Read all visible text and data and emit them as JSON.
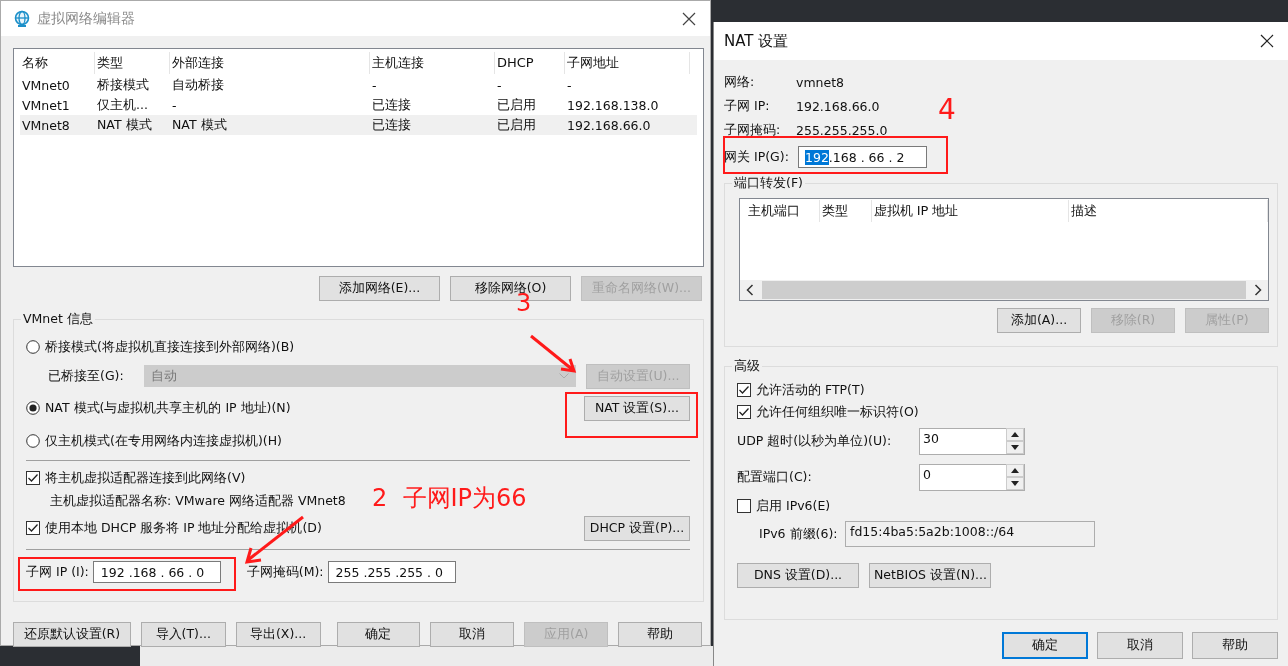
{
  "editor_window": {
    "title": "虚拟网络编辑器",
    "network_table": {
      "columns": [
        "名称",
        "类型",
        "外部连接",
        "主机连接",
        "DHCP",
        "子网地址"
      ],
      "rows": [
        {
          "cells": [
            "VMnet0",
            "桥接模式",
            "自动桥接",
            "-",
            "-",
            "-"
          ],
          "selected": false
        },
        {
          "cells": [
            "VMnet1",
            "仅主机...",
            "-",
            "已连接",
            "已启用",
            "192.168.138.0"
          ],
          "selected": false
        },
        {
          "cells": [
            "VMnet8",
            "NAT 模式",
            "NAT 模式",
            "已连接",
            "已启用",
            "192.168.66.0"
          ],
          "selected": true
        }
      ]
    },
    "table_buttons": [
      {
        "label": "添加网络(E)...",
        "disabled": false
      },
      {
        "label": "移除网络(O)",
        "disabled": false
      },
      {
        "label": "重命名网络(W)...",
        "disabled": true
      }
    ],
    "vmnet_info": {
      "title": "VMnet 信息",
      "modes": [
        {
          "label": "桥接模式(将虚拟机直接连接到外部网络)(B)",
          "selected": false
        },
        {
          "label": "NAT 模式(与虚拟机共享主机的 IP 地址)(N)",
          "selected": true
        },
        {
          "label": "仅主机模式(在专用网络内连接虚拟机)(H)",
          "selected": false
        }
      ],
      "bridged_to": {
        "label": "已桥接至(G):",
        "value": "自动",
        "disabled": true
      },
      "auto_settings_button": {
        "label": "自动设置(U)...",
        "disabled": true
      },
      "nat_settings_button": {
        "label": "NAT 设置(S)...",
        "disabled": false
      },
      "connect_adapter": {
        "label": "将主机虚拟适配器连接到此网络(V)",
        "checked": true
      },
      "adapter_name": "主机虚拟适配器名称: VMware 网络适配器 VMnet8",
      "use_dhcp": {
        "label": "使用本地 DHCP 服务将 IP 地址分配给虚拟机(D)",
        "checked": true
      },
      "dhcp_settings_button": {
        "label": "DHCP 设置(P)...",
        "disabled": false
      },
      "subnet_ip": {
        "label": "子网 IP (I):",
        "value": "192 .168 . 66 . 0"
      },
      "subnet_mask": {
        "label": "子网掩码(M):",
        "value": "255 .255 .255 . 0"
      }
    },
    "footer_buttons": [
      {
        "label": "还原默认设置(R)",
        "disabled": false
      },
      {
        "label": "导入(T)...",
        "disabled": false
      },
      {
        "label": "导出(X)...",
        "disabled": false
      },
      {
        "label": "确定",
        "disabled": false
      },
      {
        "label": "取消",
        "disabled": false
      },
      {
        "label": "应用(A)",
        "disabled": true
      },
      {
        "label": "帮助",
        "disabled": false
      }
    ]
  },
  "nat_window": {
    "title": "NAT 设置",
    "info": [
      {
        "label": "网络:",
        "value": "vmnet8"
      },
      {
        "label": "子网 IP:",
        "value": "192.168.66.0"
      },
      {
        "label": "子网掩码:",
        "value": "255.255.255.0"
      }
    ],
    "gateway": {
      "label": "网关 IP(G):",
      "segments": [
        {
          "text": "192",
          "selected": true
        },
        {
          "text": ".168 . 66 . 2",
          "selected": false
        }
      ]
    },
    "port_forwarding": {
      "title": "端口转发(F)",
      "columns": [
        "主机端口",
        "类型",
        "虚拟机 IP 地址",
        "描述"
      ],
      "buttons": [
        {
          "label": "添加(A)...",
          "disabled": false
        },
        {
          "label": "移除(R)",
          "disabled": true
        },
        {
          "label": "属性(P)",
          "disabled": true
        }
      ]
    },
    "advanced": {
      "title": "高级",
      "checks": [
        {
          "label": "允许活动的 FTP(T)",
          "checked": true
        },
        {
          "label": "允许任何组织唯一标识符(O)",
          "checked": true
        }
      ],
      "spinners": [
        {
          "label": "UDP 超时(以秒为单位)(U):",
          "value": "30"
        },
        {
          "label": "配置端口(C):",
          "value": "0"
        }
      ],
      "ipv6": {
        "label": "启用 IPv6(E)",
        "checked": false
      },
      "ipv6_prefix": {
        "label": "IPv6 前缀(6):",
        "value": "fd15:4ba5:5a2b:1008::/64"
      },
      "buttons": [
        {
          "label": "DNS 设置(D)...",
          "disabled": false
        },
        {
          "label": "NetBIOS 设置(N)...",
          "disabled": false
        }
      ]
    },
    "footer_buttons": [
      {
        "label": "确定",
        "default": true
      },
      {
        "label": "取消",
        "default": false
      },
      {
        "label": "帮助",
        "default": false
      }
    ]
  },
  "annotations": [
    "3",
    "4",
    "2  子网IP为66"
  ]
}
